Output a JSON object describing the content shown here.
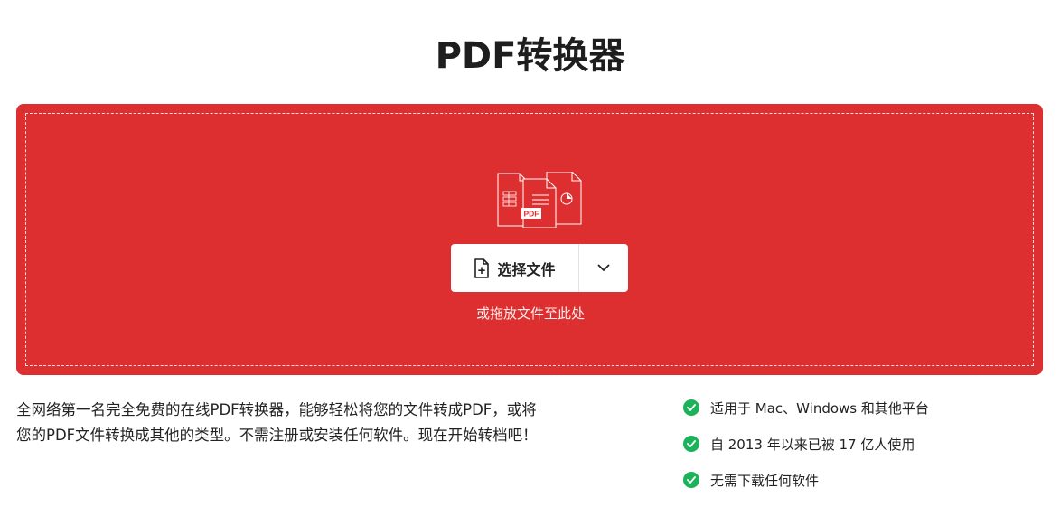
{
  "header": {
    "title": "PDF转换器"
  },
  "upload": {
    "choose_label": "选择文件",
    "drop_hint": "或拖放文件至此处",
    "accent_color": "#de2f30",
    "illustration_badge": "PDF"
  },
  "description": {
    "line1": "全网络第一名完全免费的在线PDF转换器，能够轻松将您的文件转成PDF，或将",
    "line2": "您的PDF文件转换成其他的类型。不需注册或安装任何软件。现在开始转档吧！"
  },
  "features": {
    "items": [
      {
        "label": "适用于 Mac、Windows 和其他平台"
      },
      {
        "label": "自 2013 年以来已被 17 亿人使用"
      },
      {
        "label": "无需下载任何软件"
      }
    ],
    "check_color": "#1cb25c"
  }
}
